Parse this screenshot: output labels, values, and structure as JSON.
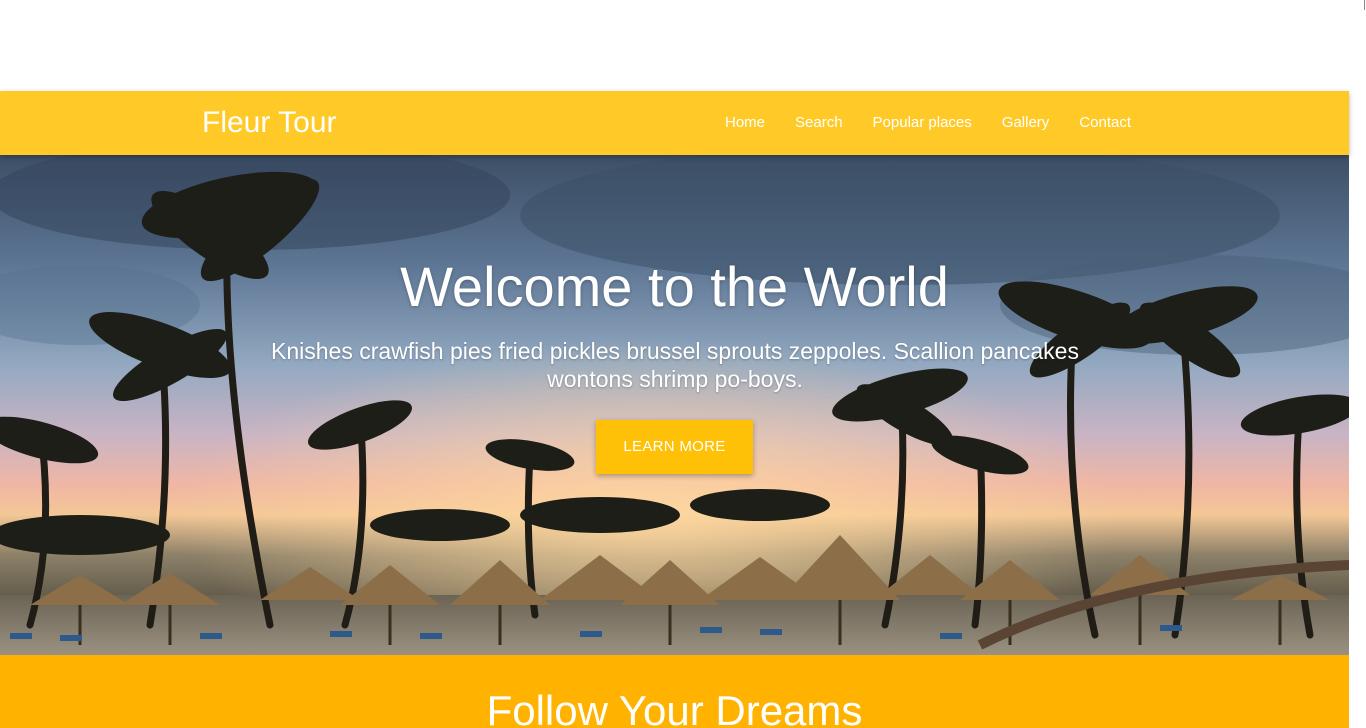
{
  "navbar": {
    "brand": "Fleur Tour",
    "links": [
      "Home",
      "Search",
      "Popular places",
      "Gallery",
      "Contact"
    ]
  },
  "hero": {
    "title": "Welcome to the World",
    "subtitle": "Knishes crawfish pies fried pickles brussel sprouts zeppoles. Scallion pancakes wontons shrimp po-boys.",
    "button_label": "LEARN MORE",
    "image_subject": "tropical beach with palm trees and straw umbrellas at sunset"
  },
  "section": {
    "title": "Follow Your Dreams"
  },
  "colors": {
    "navbar": "#ffca28",
    "button": "#ffc107",
    "band": "#ffb300",
    "text": "#ffffff"
  }
}
